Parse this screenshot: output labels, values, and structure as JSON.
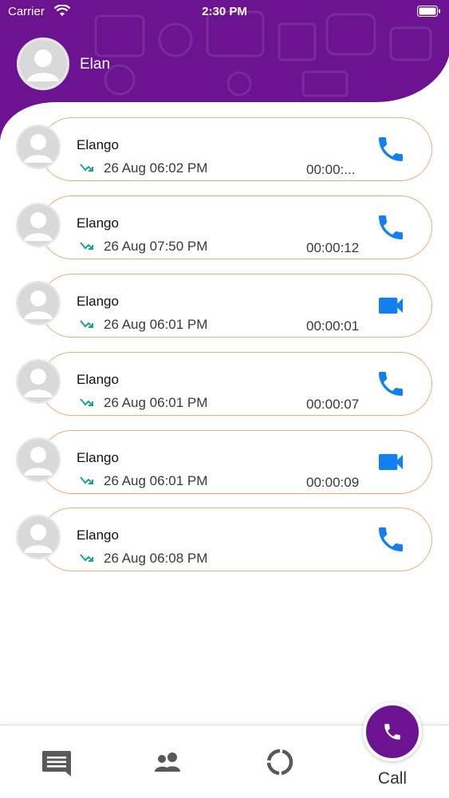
{
  "status_bar": {
    "carrier": "Carrier",
    "time": "2:30 PM",
    "icons": [
      "wifi-icon",
      "battery-icon"
    ]
  },
  "header": {
    "profile_name": "Elan",
    "avatar_icon": "avatar-placeholder-icon"
  },
  "colors": {
    "header": "#6b1390",
    "card_border": "#ecad78",
    "call_icon": "#1480f0",
    "direction_arrow": "#1aa58a",
    "fab": "#6b1390"
  },
  "calls": [
    {
      "name": "Elango",
      "time": "26 Aug 06:02 PM",
      "duration": "00:00:...",
      "direction": "outgoing-arrow-icon",
      "type": "phone"
    },
    {
      "name": "Elango",
      "time": "26 Aug 07:50 PM",
      "duration": "00:00:12",
      "direction": "outgoing-arrow-icon",
      "type": "phone"
    },
    {
      "name": "Elango",
      "time": "26 Aug 06:01 PM",
      "duration": "00:00:01",
      "direction": "outgoing-arrow-icon",
      "type": "video"
    },
    {
      "name": "Elango",
      "time": "26 Aug 06:01 PM",
      "duration": "00:00:07",
      "direction": "outgoing-arrow-icon",
      "type": "phone"
    },
    {
      "name": "Elango",
      "time": "26 Aug 06:01 PM",
      "duration": "00:00:09",
      "direction": "outgoing-arrow-icon",
      "type": "video"
    },
    {
      "name": "Elango",
      "time": "26 Aug 06:08 PM",
      "duration": "",
      "direction": "outgoing-arrow-icon",
      "type": "phone"
    }
  ],
  "bottom_nav": {
    "items": [
      {
        "icon": "chat-icon"
      },
      {
        "icon": "contacts-icon"
      },
      {
        "icon": "status-icon"
      },
      {
        "icon": "phone-icon",
        "label": "Call",
        "active": true
      }
    ]
  }
}
